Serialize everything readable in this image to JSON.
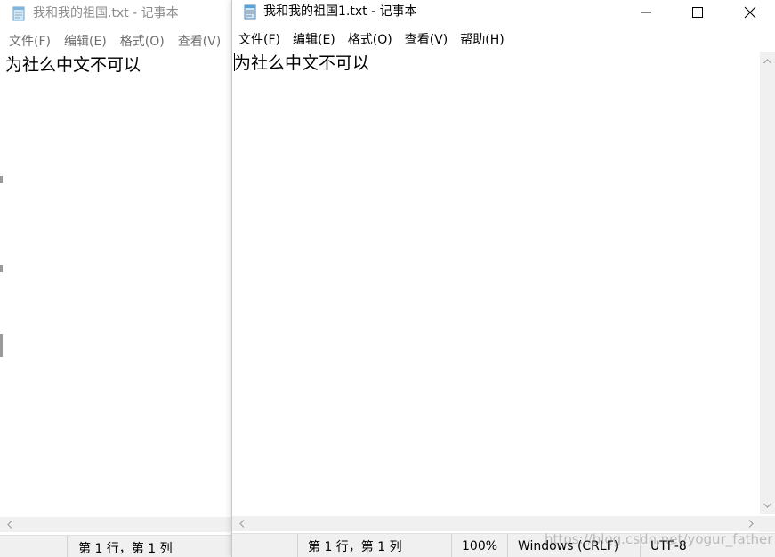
{
  "back_window": {
    "title": "我和我的祖国.txt - 记事本",
    "menu": [
      "文件(F)",
      "编辑(E)",
      "格式(O)",
      "查看(V)"
    ],
    "content": "为社么中文不可以",
    "status": {
      "position": "第 1 行，第 1 列"
    }
  },
  "front_window": {
    "title": "我和我的祖国1.txt - 记事本",
    "menu": [
      "文件(F)",
      "编辑(E)",
      "格式(O)",
      "查看(V)",
      "帮助(H)"
    ],
    "content": "为社么中文不可以",
    "status": {
      "position": "第 1 行，第 1 列",
      "zoom": "100%",
      "line_ending": "Windows (CRLF)",
      "encoding": "UTF-8"
    },
    "caption_buttons": [
      "minimize-icon",
      "maximize-icon",
      "close-icon"
    ]
  },
  "watermark": "https://blog.csdn.net/yogur_father",
  "colors": {
    "inactive_text": "#8a8a8a",
    "scrollbar_bg": "#f0f0f0",
    "statusbar_bg": "#f0f0f0"
  }
}
